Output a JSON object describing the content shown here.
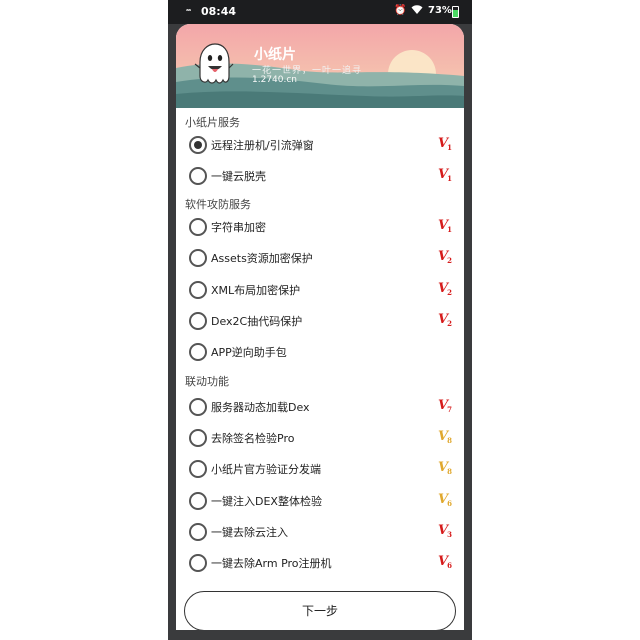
{
  "status": {
    "signal": "ᵃᵃ",
    "time": "08:44",
    "alarm_icon": "alarm-clock-icon",
    "wifi_icon": "wifi-icon",
    "battery": "73%"
  },
  "header": {
    "app_name": "小纸片",
    "slogan": "一花一世界，一叶一追寻",
    "site": "1.2740.cn"
  },
  "sections": [
    {
      "title": "小纸片服务"
    },
    {
      "title": "软件攻防服务"
    },
    {
      "title": "联动功能"
    }
  ],
  "options": [
    {
      "label": "远程注册机/引流弹窗",
      "checked": true,
      "badge": "1",
      "badge_color": "red"
    },
    {
      "label": "一键云脱壳",
      "checked": false,
      "badge": "1",
      "badge_color": "red"
    },
    {
      "label": "字符串加密",
      "checked": false,
      "badge": "1",
      "badge_color": "red"
    },
    {
      "label": "Assets资源加密保护",
      "checked": false,
      "badge": "2",
      "badge_color": "red"
    },
    {
      "label": "XML布局加密保护",
      "checked": false,
      "badge": "2",
      "badge_color": "red"
    },
    {
      "label": "Dex2C抽代码保护",
      "checked": false,
      "badge": "2",
      "badge_color": "red"
    },
    {
      "label": "APP逆向助手包",
      "checked": false,
      "badge": "",
      "badge_color": ""
    },
    {
      "label": "服务器动态加载Dex",
      "checked": false,
      "badge": "7",
      "badge_color": "red"
    },
    {
      "label": "去除签名检验Pro",
      "checked": false,
      "badge": "8",
      "badge_color": "gold"
    },
    {
      "label": "小纸片官方验证分发端",
      "checked": false,
      "badge": "8",
      "badge_color": "gold"
    },
    {
      "label": "一键注入DEX整体检验",
      "checked": false,
      "badge": "6",
      "badge_color": "gold"
    },
    {
      "label": "一键去除云注入",
      "checked": false,
      "badge": "3",
      "badge_color": "red"
    },
    {
      "label": "一键去除Arm Pro注册机",
      "checked": false,
      "badge": "6",
      "badge_color": "red"
    }
  ],
  "badge_letter": "V",
  "next_button": "下一步",
  "colors": {
    "badge_red": "#d61c1c",
    "badge_gold": "#e0a82e"
  }
}
